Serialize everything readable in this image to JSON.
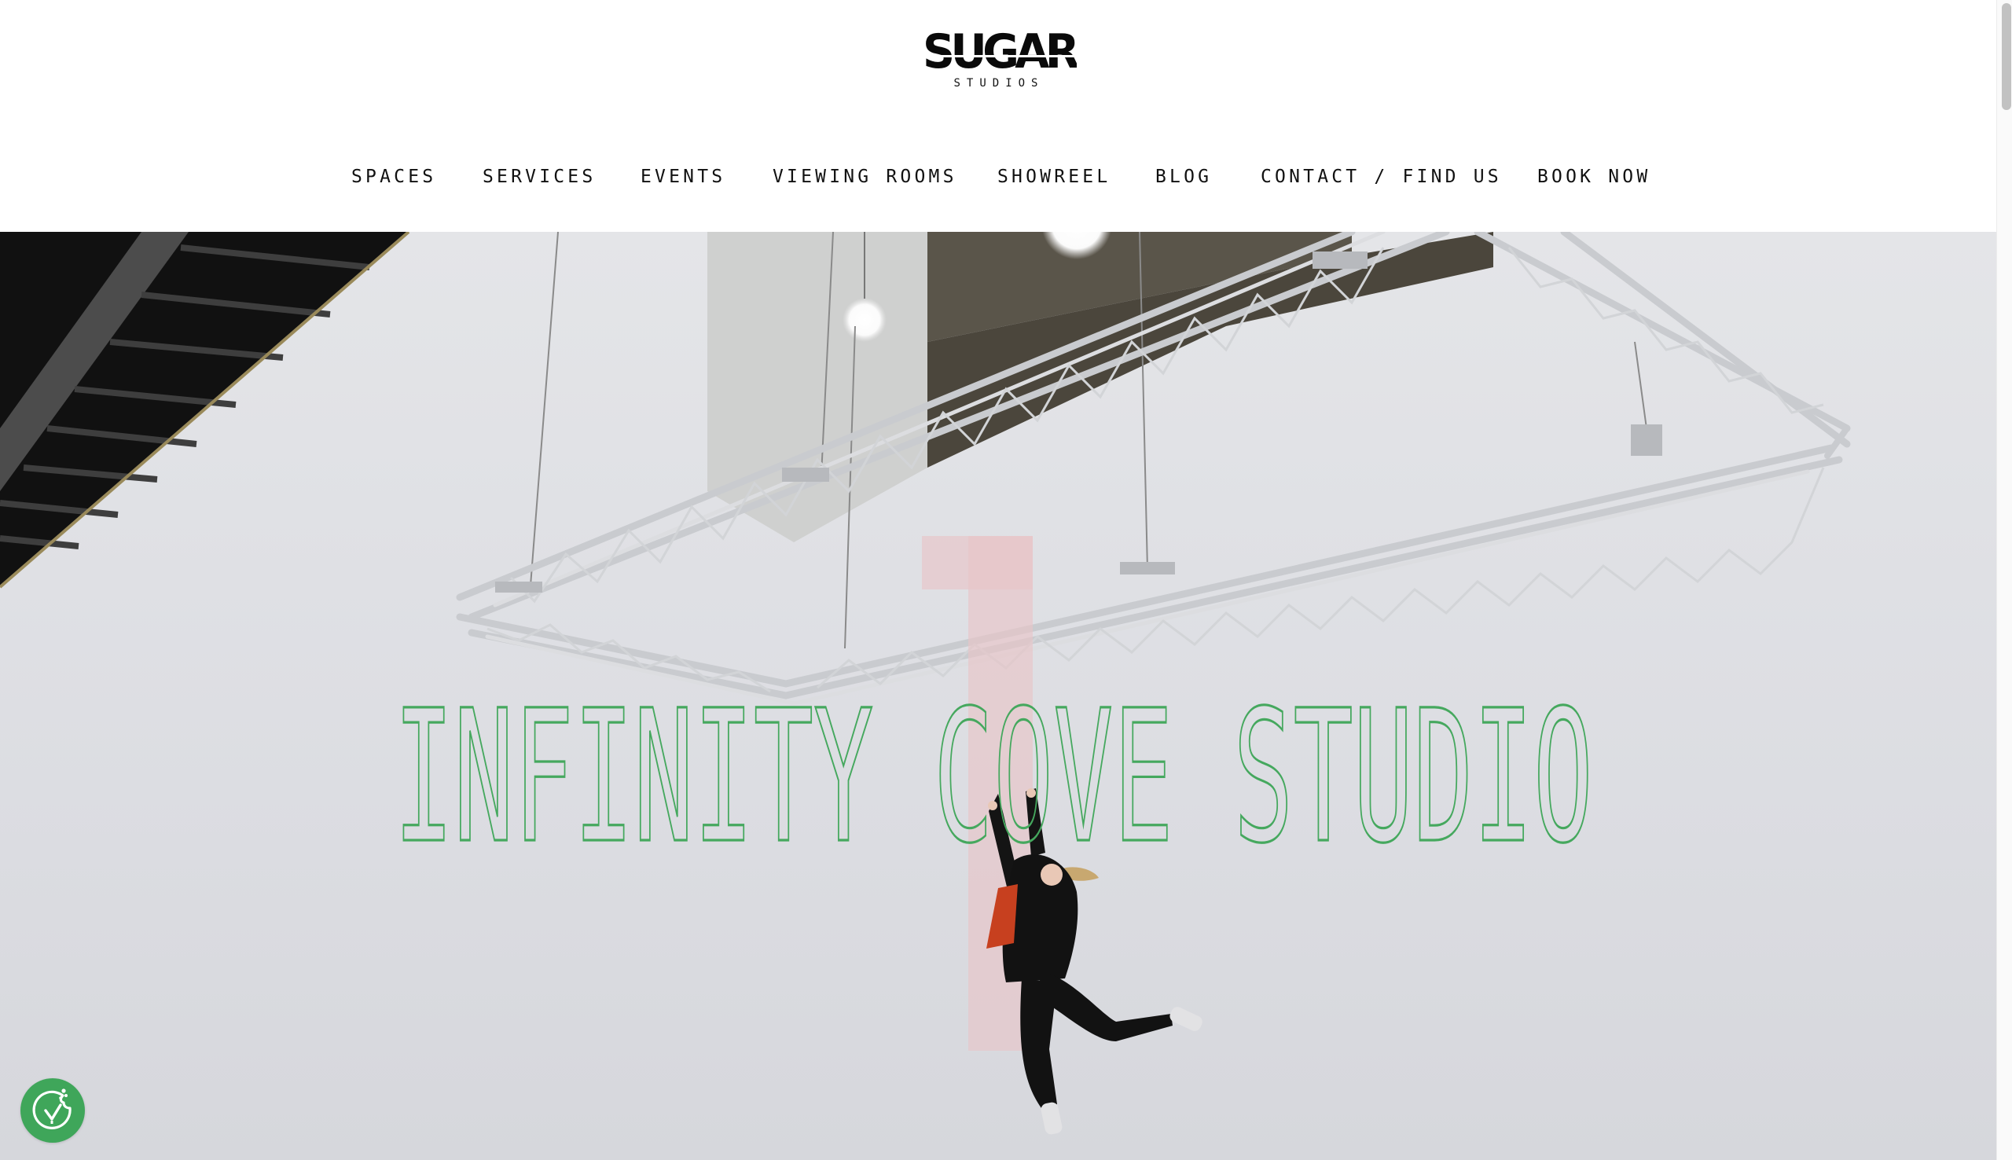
{
  "brand": {
    "name": "SUGAR",
    "subtitle": "STUDIOS"
  },
  "nav": {
    "items": [
      {
        "label": "SPACES"
      },
      {
        "label": "SERVICES"
      },
      {
        "label": "EVENTS"
      },
      {
        "label": "VIEWING ROOMS"
      },
      {
        "label": "SHOWREEL"
      },
      {
        "label": "BLOG"
      },
      {
        "label": "CONTACT / FIND US"
      },
      {
        "label": "BOOK NOW"
      }
    ]
  },
  "hero": {
    "title": "INFINITY COVE STUDIO",
    "number": "1",
    "title_color": "#45a85e",
    "number_color": "#e8c5c8",
    "image_description": "Person jumping in white infinity cove studio beneath suspended aluminium lighting truss"
  },
  "cookie_consent": {
    "icon": "cookie-check-icon",
    "color": "#3fa65a"
  }
}
